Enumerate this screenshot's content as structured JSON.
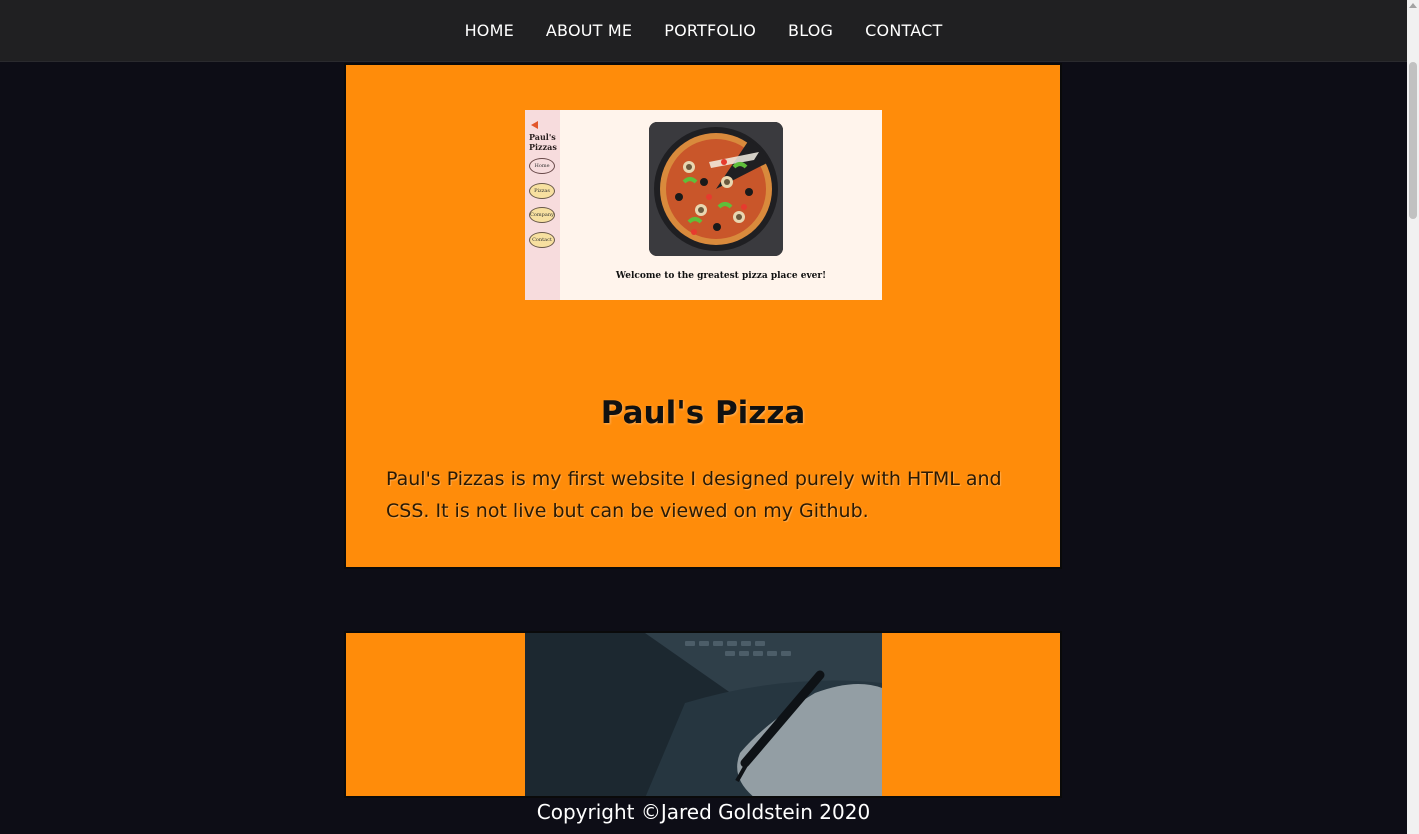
{
  "nav": {
    "items": [
      "HOME",
      "ABOUT ME",
      "PORTFOLIO",
      "BLOG",
      "CONTACT"
    ]
  },
  "project": {
    "title": "Paul's Pizza",
    "description": "Paul's Pizzas is my first website I designed purely with HTML and CSS. It is not live but can be viewed on my Github."
  },
  "screenshot": {
    "brand": "Paul's Pizzas",
    "nav_items": [
      "Home",
      "Pizzas",
      "Company",
      "Contact"
    ],
    "welcome": "Welcome to the greatest pizza place ever!"
  },
  "footer": {
    "copyright": "Copyright ©Jared Goldstein 2020"
  },
  "colors": {
    "card_bg": "#ff8c0a",
    "page_bg": "#0d0d16",
    "nav_bg": "#202022"
  }
}
